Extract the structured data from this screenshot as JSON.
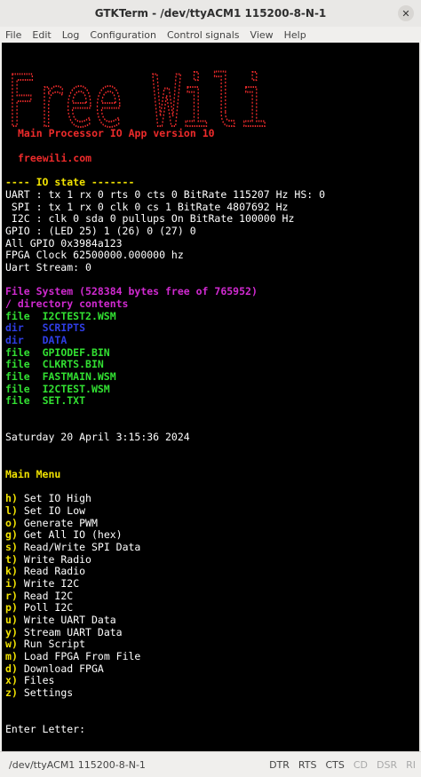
{
  "window": {
    "title": "GTKTerm - /dev/ttyACM1  115200-8-N-1"
  },
  "menu": [
    "File",
    "Edit",
    "Log",
    "Configuration",
    "Control signals",
    "View",
    "Help"
  ],
  "colors": {
    "red": "#ee2b2b",
    "yellow": "#f1e200",
    "magenta": "#d02ad0",
    "green": "#32e032",
    "blue": "#2f3ee6"
  },
  "terminal": {
    "logo_text": "Free Wili",
    "app_version": "Main Processor IO App version 10",
    "website": "freewili.com",
    "io_state_header": "---- IO state -------",
    "io_lines": [
      "UART : tx 1 rx 0 rts 0 cts 0 BitRate 115207 Hz HS: 0",
      " SPI : tx 1 rx 0 clk 0 cs 1 BitRate 4807692 Hz",
      " I2C : clk 0 sda 0 pullups On BitRate 100000 Hz",
      "GPIO : (LED 25) 1 (26) 0 (27) 0",
      "All GPIO 0x3984a123",
      "FPGA Clock 62500000.000000 hz",
      "Uart Stream: 0"
    ],
    "fs_header": "File System (528384 bytes free of 765952)",
    "fs_subheader": "/ directory contents",
    "entries": [
      {
        "kind": "file",
        "name": "I2CTEST2.WSM"
      },
      {
        "kind": "dir",
        "name": "SCRIPTS"
      },
      {
        "kind": "dir",
        "name": "DATA"
      },
      {
        "kind": "file",
        "name": "GPIODEF.BIN"
      },
      {
        "kind": "file",
        "name": "CLKRTS.BIN"
      },
      {
        "kind": "file",
        "name": "FASTMAIN.WSM"
      },
      {
        "kind": "file",
        "name": "I2CTEST.WSM"
      },
      {
        "kind": "file",
        "name": "SET.TXT"
      }
    ],
    "datetime": "Saturday 20 April 3:15:36 2024",
    "main_menu_title": "Main Menu",
    "menu_items": [
      {
        "key": "h",
        "label": "Set IO High"
      },
      {
        "key": "l",
        "label": "Set IO Low"
      },
      {
        "key": "o",
        "label": "Generate PWM"
      },
      {
        "key": "g",
        "label": "Get All IO (hex)"
      },
      {
        "key": "s",
        "label": "Read/Write SPI Data"
      },
      {
        "key": "t",
        "label": "Write Radio"
      },
      {
        "key": "k",
        "label": "Read Radio"
      },
      {
        "key": "i",
        "label": "Write I2C"
      },
      {
        "key": "r",
        "label": "Read I2C"
      },
      {
        "key": "p",
        "label": "Poll I2C"
      },
      {
        "key": "u",
        "label": "Write UART Data"
      },
      {
        "key": "y",
        "label": "Stream UART Data"
      },
      {
        "key": "w",
        "label": "Run Script"
      },
      {
        "key": "m",
        "label": "Load FPGA From File"
      },
      {
        "key": "d",
        "label": "Download FPGA"
      },
      {
        "key": "x",
        "label": "Files"
      },
      {
        "key": "z",
        "label": "Settings"
      }
    ],
    "prompt": "Enter Letter:"
  },
  "statusbar": {
    "port": "/dev/ttyACM1  115200-8-N-1",
    "signals": [
      {
        "name": "DTR",
        "active": true
      },
      {
        "name": "RTS",
        "active": true
      },
      {
        "name": "CTS",
        "active": true
      },
      {
        "name": "CD",
        "active": false
      },
      {
        "name": "DSR",
        "active": false
      },
      {
        "name": "RI",
        "active": false
      }
    ]
  }
}
